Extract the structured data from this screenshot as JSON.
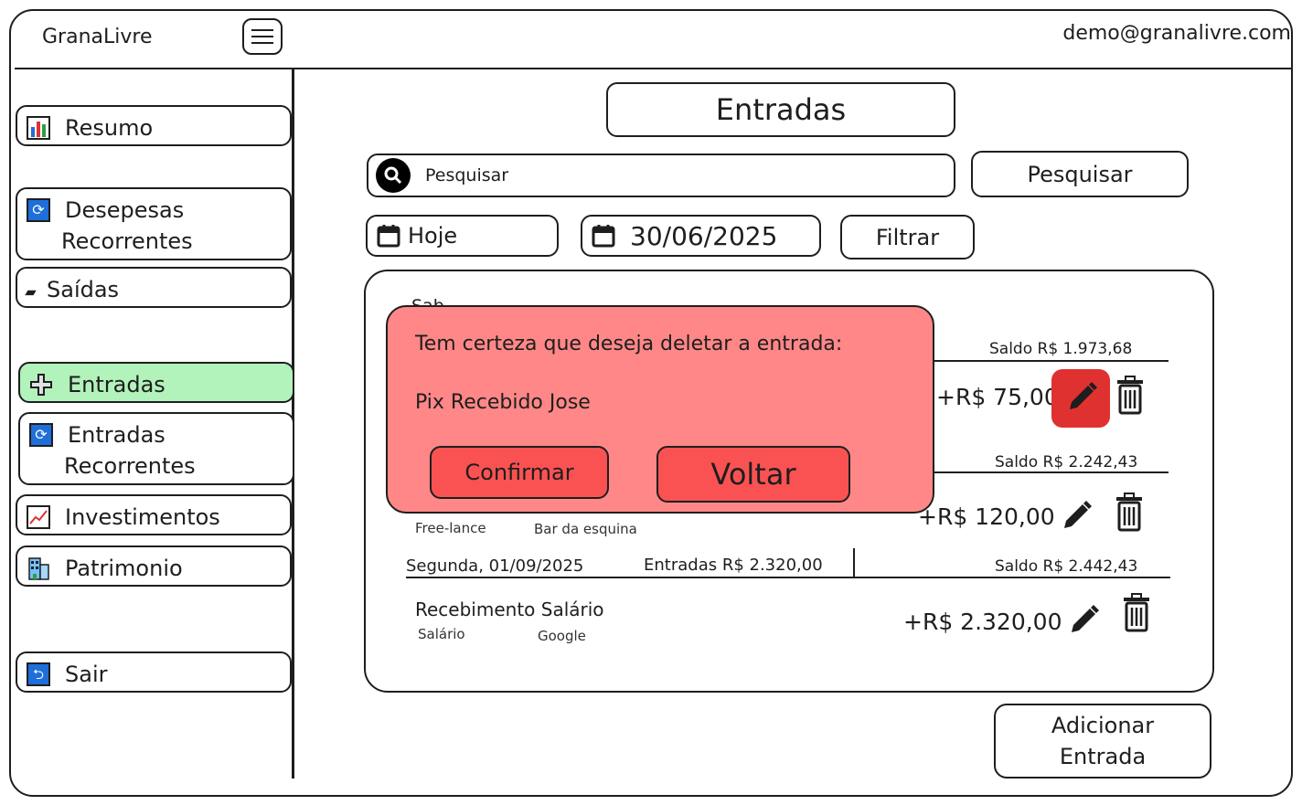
{
  "header": {
    "brand": "GranaLivre",
    "user_email": "demo@granalivre.com"
  },
  "sidebar": {
    "items": [
      {
        "label": "Resumo",
        "icon": "bar-chart-icon"
      },
      {
        "label_line1": "Desepesas",
        "label_line2": "Recorrentes",
        "icon": "sync-icon"
      },
      {
        "label": "Saídas",
        "icon": "minus-icon"
      },
      {
        "label": "Entradas",
        "icon": "plus-icon",
        "active": true
      },
      {
        "label_line1": "Entradas",
        "label_line2": "Recorrentes",
        "icon": "sync-icon"
      },
      {
        "label": "Investimentos",
        "icon": "chart-increasing-icon"
      },
      {
        "label": "Patrimonio",
        "icon": "building-icon"
      },
      {
        "label": "Sair",
        "icon": "return-icon"
      }
    ]
  },
  "main": {
    "title": "Entradas",
    "search": {
      "placeholder": "Pesquisar",
      "button_label": "Pesquisar"
    },
    "filters": {
      "period": "Hoje",
      "date": "30/06/2025",
      "button_label": "Filtrar"
    },
    "days": [
      {
        "header_fragment": "Sab",
        "balance": "Saldo R$ 1.973,68",
        "entries": [
          {
            "amount": "+R$ 75,00"
          }
        ]
      },
      {
        "balance": "Saldo R$ 2.242,43",
        "entries": [
          {
            "category": "Free-lance",
            "source": "Bar da esquina",
            "amount": "+R$ 120,00"
          }
        ]
      },
      {
        "date": "Segunda, 01/09/2025",
        "total": "Entradas R$ 2.320,00",
        "balance": "Saldo R$ 2.442,43",
        "entries": [
          {
            "title": "Recebimento Salário",
            "category": "Salário",
            "source": "Google",
            "amount": "+R$ 2.320,00"
          }
        ]
      }
    ],
    "add_button": {
      "line1": "Adicionar",
      "line2": "Entrada"
    }
  },
  "modal": {
    "question": "Tem certeza que deseja deletar a entrada:",
    "entry_name": "Pix Recebido Jose",
    "confirm_label": "Confirmar",
    "back_label": "Voltar"
  },
  "colors": {
    "active_nav": "#b2f2bb",
    "modal_bg": "#ff8787",
    "modal_button": "#fa5252",
    "edit_active": "#e03131"
  }
}
